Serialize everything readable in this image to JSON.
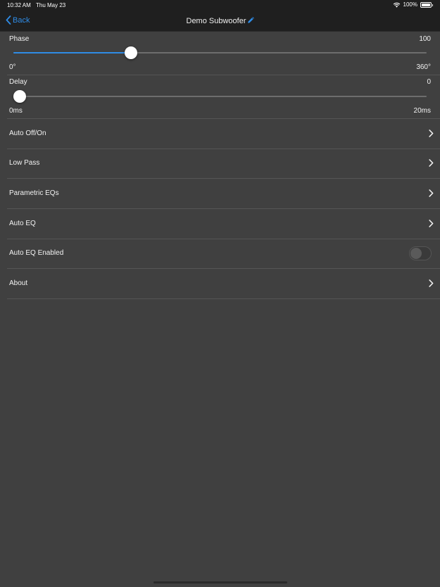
{
  "status_bar": {
    "time": "10:32 AM",
    "date": "Thu May 23",
    "battery": "100%",
    "icons": [
      "wifi-icon",
      "battery-icon"
    ]
  },
  "nav": {
    "back_label": "Back",
    "title": "Demo Subwoofer",
    "icons": [
      "chevron-left-icon",
      "pencil-icon"
    ]
  },
  "colors": {
    "accent": "#2f8ce6",
    "background": "#404040",
    "bar": "#1f1f1f"
  },
  "sliders": {
    "phase": {
      "label": "Phase",
      "value": "100",
      "min": "0°",
      "max": "360°",
      "fraction": 0.285
    },
    "delay": {
      "label": "Delay",
      "value": "0",
      "min": "0ms",
      "max": "20ms",
      "fraction": 0.0
    }
  },
  "rows": {
    "auto_off_on": "Auto Off/On",
    "low_pass": "Low Pass",
    "parametric_eqs": "Parametric EQs",
    "auto_eq": "Auto EQ",
    "auto_eq_enabled": "Auto EQ Enabled",
    "about": "About"
  },
  "auto_eq_enabled_on": false
}
